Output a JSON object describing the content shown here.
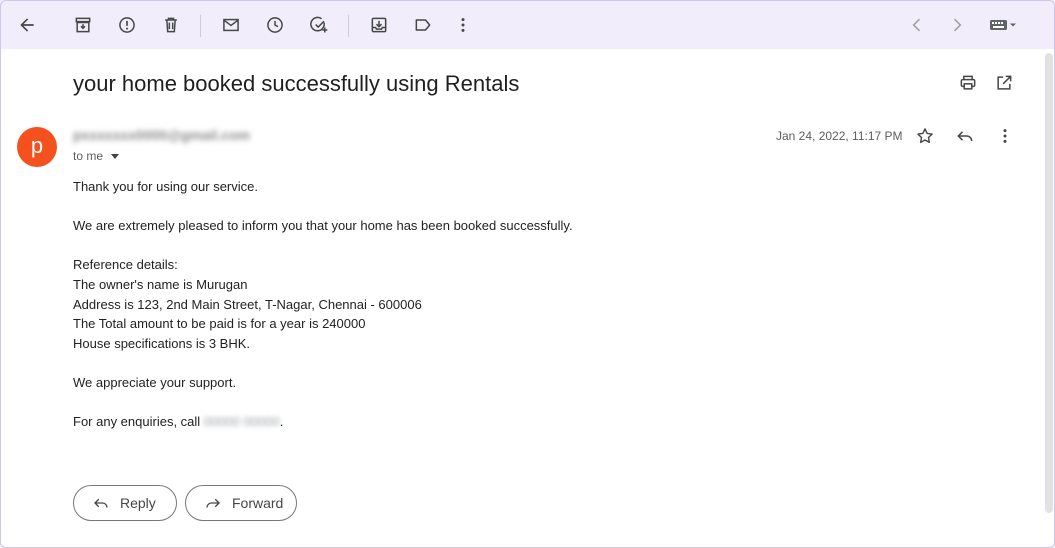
{
  "colors": {
    "toolbar_bg": "#f1edfa",
    "avatar_bg": "#f4511e",
    "content_bg": "#ffffff"
  },
  "toolbar": {
    "back": "arrow-left-icon",
    "archive": "archive-icon",
    "report_spam": "report-spam-icon",
    "delete": "trash-icon",
    "mark_unread": "mail-icon",
    "snooze": "clock-icon",
    "add_task": "add-task-icon",
    "move_to": "move-to-inbox-icon",
    "label": "label-icon",
    "more": "more-vert-icon",
    "prev": "chevron-left-icon",
    "next": "chevron-right-icon",
    "input_tools": "keyboard-icon"
  },
  "email": {
    "subject": "your home booked successfully using Rentals",
    "avatar_letter": "p",
    "sender": "pxxxxxxx0000@gmail.com",
    "to_label": "to me",
    "date": "Jan 24, 2022, 11:17 PM",
    "body": {
      "line1": "Thank you for using our service.",
      "line2": "We are extremely pleased to inform you that your home has been booked successfully.",
      "line3": "Reference details:",
      "line4": "The owner's name is Murugan",
      "line5": "Address is 123, 2nd Main Street, T-Nagar, Chennai - 600006",
      "line6": "The Total amount to be paid is for a year is 240000",
      "line7": "House specifications is 3 BHK.",
      "line8": "We appreciate your support.",
      "line9_prefix": "For any enquiries, call ",
      "phone": "00000 00000",
      "line9_suffix": "."
    }
  },
  "actions": {
    "reply_label": "Reply",
    "forward_label": "Forward"
  }
}
